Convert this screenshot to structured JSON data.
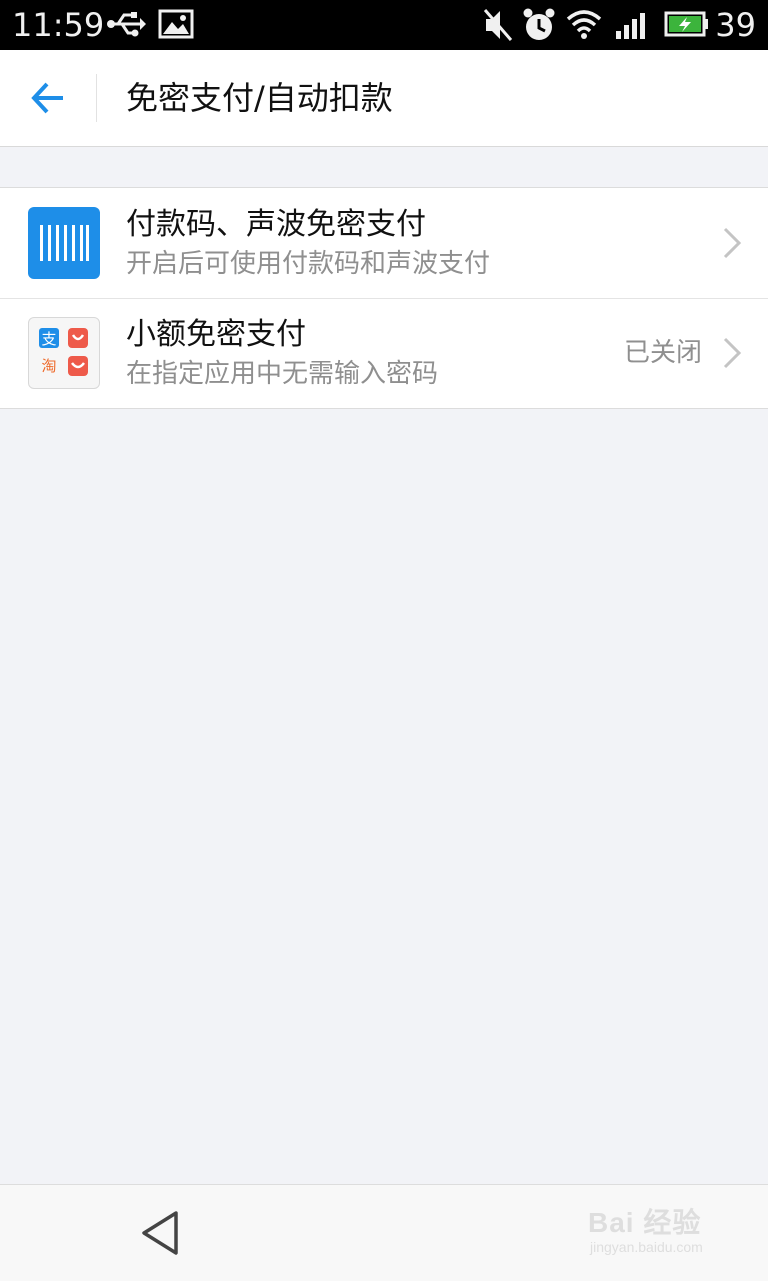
{
  "status_bar": {
    "time": "11:59",
    "battery_level": "39",
    "icons": [
      "usb-icon",
      "image-icon",
      "mute-icon",
      "alarm-icon",
      "wifi-icon",
      "signal-icon",
      "battery-charging-icon"
    ]
  },
  "header": {
    "back_icon": "arrow-left-icon",
    "title": "免密支付/自动扣款",
    "accent_color": "#1e8ee8"
  },
  "settings": {
    "items": [
      {
        "icon": "barcode-icon",
        "title": "付款码、声波免密支付",
        "subtitle": "开启后可使用付款码和声波支付",
        "status": ""
      },
      {
        "icon": "alipay-taobao-apps-icon",
        "title": "小额免密支付",
        "subtitle": "在指定应用中无需输入密码",
        "status": "已关闭"
      }
    ]
  },
  "nav_bar": {
    "back_icon": "triangle-back-icon",
    "watermark_main": "Bai 经验",
    "watermark_sub": "jingyan.baidu.com"
  }
}
